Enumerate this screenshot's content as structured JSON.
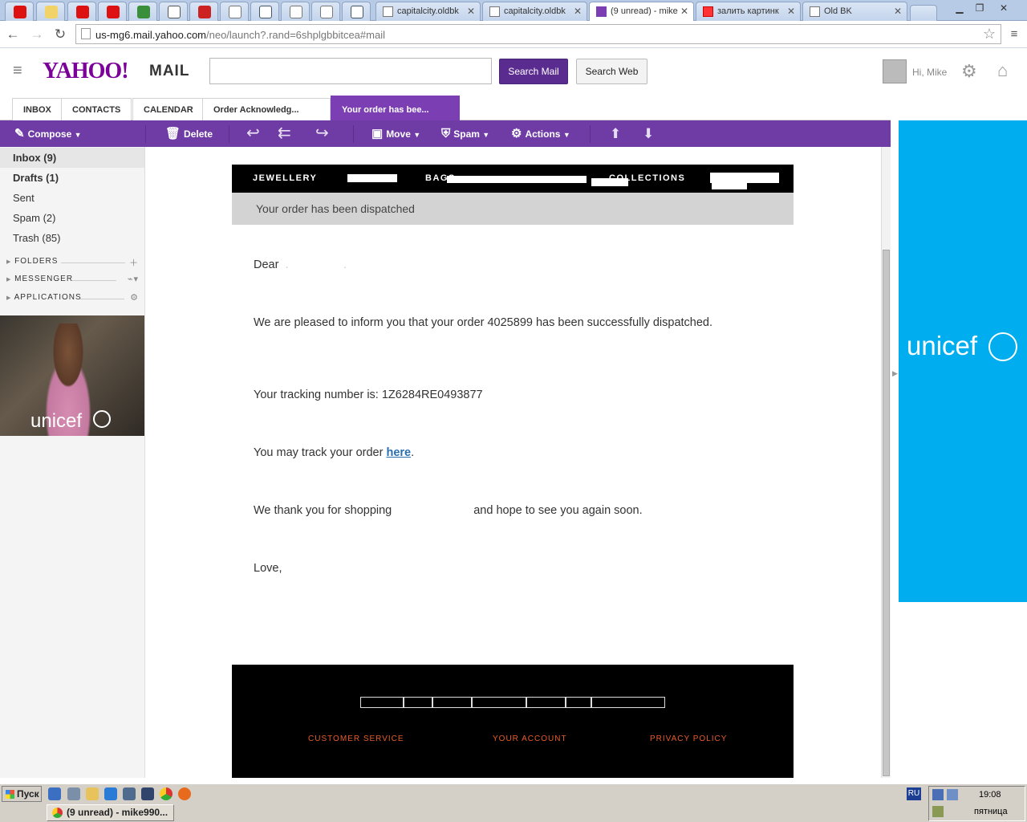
{
  "browser": {
    "tabs": [
      {
        "title": "capitalcity.oldbk",
        "active": false
      },
      {
        "title": "capitalcity.oldbk",
        "active": false
      },
      {
        "title": "(9 unread) - mike",
        "active": true
      },
      {
        "title": "залить картинк",
        "active": false
      },
      {
        "title": "Old BK",
        "active": false
      }
    ],
    "url_host": "us-mg6.mail.yahoo.com",
    "url_path": "/neo/launch?.rand=6shplgbbitcea#mail"
  },
  "header": {
    "logo": "YAHOO!",
    "logo_mail": "MAIL",
    "search_placeholder": "",
    "search_mail_label": "Search Mail",
    "search_web_label": "Search Web",
    "greeting": "Hi, Mike"
  },
  "mail_tabs": [
    {
      "label": "INBOX"
    },
    {
      "label": "CONTACTS"
    },
    {
      "label": "CALENDAR"
    },
    {
      "label": "Order Acknowledg..."
    },
    {
      "label": "Your order has bee..."
    }
  ],
  "toolbar": {
    "compose": "Compose",
    "delete": "Delete",
    "move": "Move",
    "spam": "Spam",
    "actions": "Actions"
  },
  "folders": [
    {
      "label": "Inbox (9)",
      "bold": true,
      "selected": true
    },
    {
      "label": "Drafts (1)",
      "bold": true,
      "selected": false
    },
    {
      "label": "Sent",
      "bold": false,
      "selected": false
    },
    {
      "label": "Spam (2)",
      "bold": false,
      "selected": false
    },
    {
      "label": "Trash (85)",
      "bold": false,
      "selected": false
    }
  ],
  "sections": [
    {
      "label": "FOLDERS"
    },
    {
      "label": "MESSENGER"
    },
    {
      "label": "APPLICATIONS"
    }
  ],
  "ads": {
    "left_brand": "unicef",
    "right_brand": "unicef"
  },
  "email": {
    "nav": [
      "JEWELLERY",
      "BAGS",
      "COLLECTIONS"
    ],
    "banner": "Your order has been dispatched",
    "greeting": "Dear",
    "p1": "We are pleased to inform you that your order 4025899 has been successfully dispatched.",
    "tracking": "Your tracking number is:  1Z6284RE0493877",
    "track_before": "You may track your order ",
    "track_link": "here",
    "track_after": ".",
    "thanks_a": "We thank you for shopping",
    "thanks_b": "and hope to see you again soon.",
    "signoff": "Love,",
    "footer_links": [
      "CUSTOMER SERVICE",
      "YOUR ACCOUNT",
      "PRIVACY POLICY"
    ]
  },
  "taskbar": {
    "start": "Пуск",
    "task": "(9 unread) - mike990...",
    "lang": "RU",
    "time": "19:08",
    "day": "пятница"
  }
}
